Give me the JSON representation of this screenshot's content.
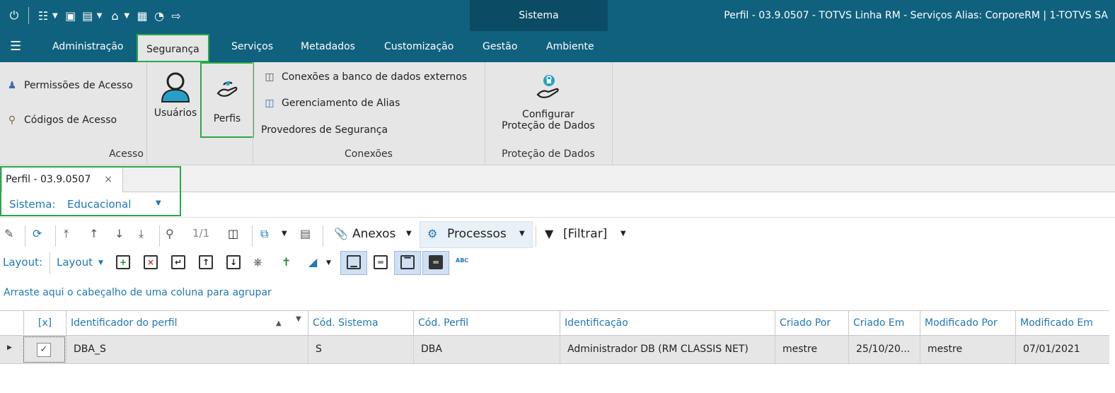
{
  "title_bar": {
    "center_tab": "Sistema",
    "app_title": "Perfil - 03.9.0507 - TOTVS Linha RM - Serviços  Alias: CorporeRM | 1-TOTVS SA"
  },
  "menu": {
    "items": [
      "Administração",
      "Segurança",
      "Serviços",
      "Metadados",
      "Customização",
      "Gestão",
      "Ambiente"
    ],
    "active": "Segurança"
  },
  "ribbon": {
    "acesso": {
      "permissoes": "Permissões de Acesso",
      "codigos": "Códigos de Acesso",
      "usuarios": "Usuários",
      "perfis": "Perfis",
      "label": "Acesso"
    },
    "conexoes": {
      "bd_externos": "Conexões a banco de dados externos",
      "alias": "Gerenciamento de Alias",
      "provedores": "Provedores de Segurança",
      "label": "Conexões"
    },
    "protecao": {
      "configurar_1": "Configurar",
      "configurar_2": "Proteção de Dados",
      "label": "Proteção de Dados"
    }
  },
  "doc_tab": {
    "title": "Perfil - 03.9.0507",
    "close": "×"
  },
  "filter": {
    "sistema_label": "Sistema:",
    "sistema_value": "Educacional"
  },
  "toolbar1": {
    "page": "1/1",
    "anexos": "Anexos",
    "processos": "Processos",
    "filtrar": "[Filtrar]"
  },
  "toolbar2": {
    "layout_label": "Layout:",
    "layout_button": "Layout",
    "abc": "ABC"
  },
  "group_hint": "Arraste aqui o cabeçalho de uma coluna para agrupar",
  "grid": {
    "columns": [
      "[x]",
      "Identificador do perfil",
      "Cód. Sistema",
      "Cód. Perfil",
      "Identificação",
      "Criado Por",
      "Criado Em",
      "Modificado Por",
      "Modificado Em"
    ],
    "rows": [
      {
        "checked": "✓",
        "identificador": "DBA_S",
        "cod_sistema": "S",
        "cod_perfil": "DBA",
        "identificacao": "Administrador DB (RM CLASSIS NET)",
        "criado_por": "mestre",
        "criado_em": "25/10/20...",
        "modificado_por": "mestre",
        "modificado_em": "07/01/2021"
      }
    ]
  },
  "colors": {
    "header_bg": "#10617e",
    "header_dark": "#0b4b63",
    "ribbon_bg": "#e6e6e6",
    "highlight_green": "#2aa84a",
    "link_blue": "#1f78b4"
  }
}
